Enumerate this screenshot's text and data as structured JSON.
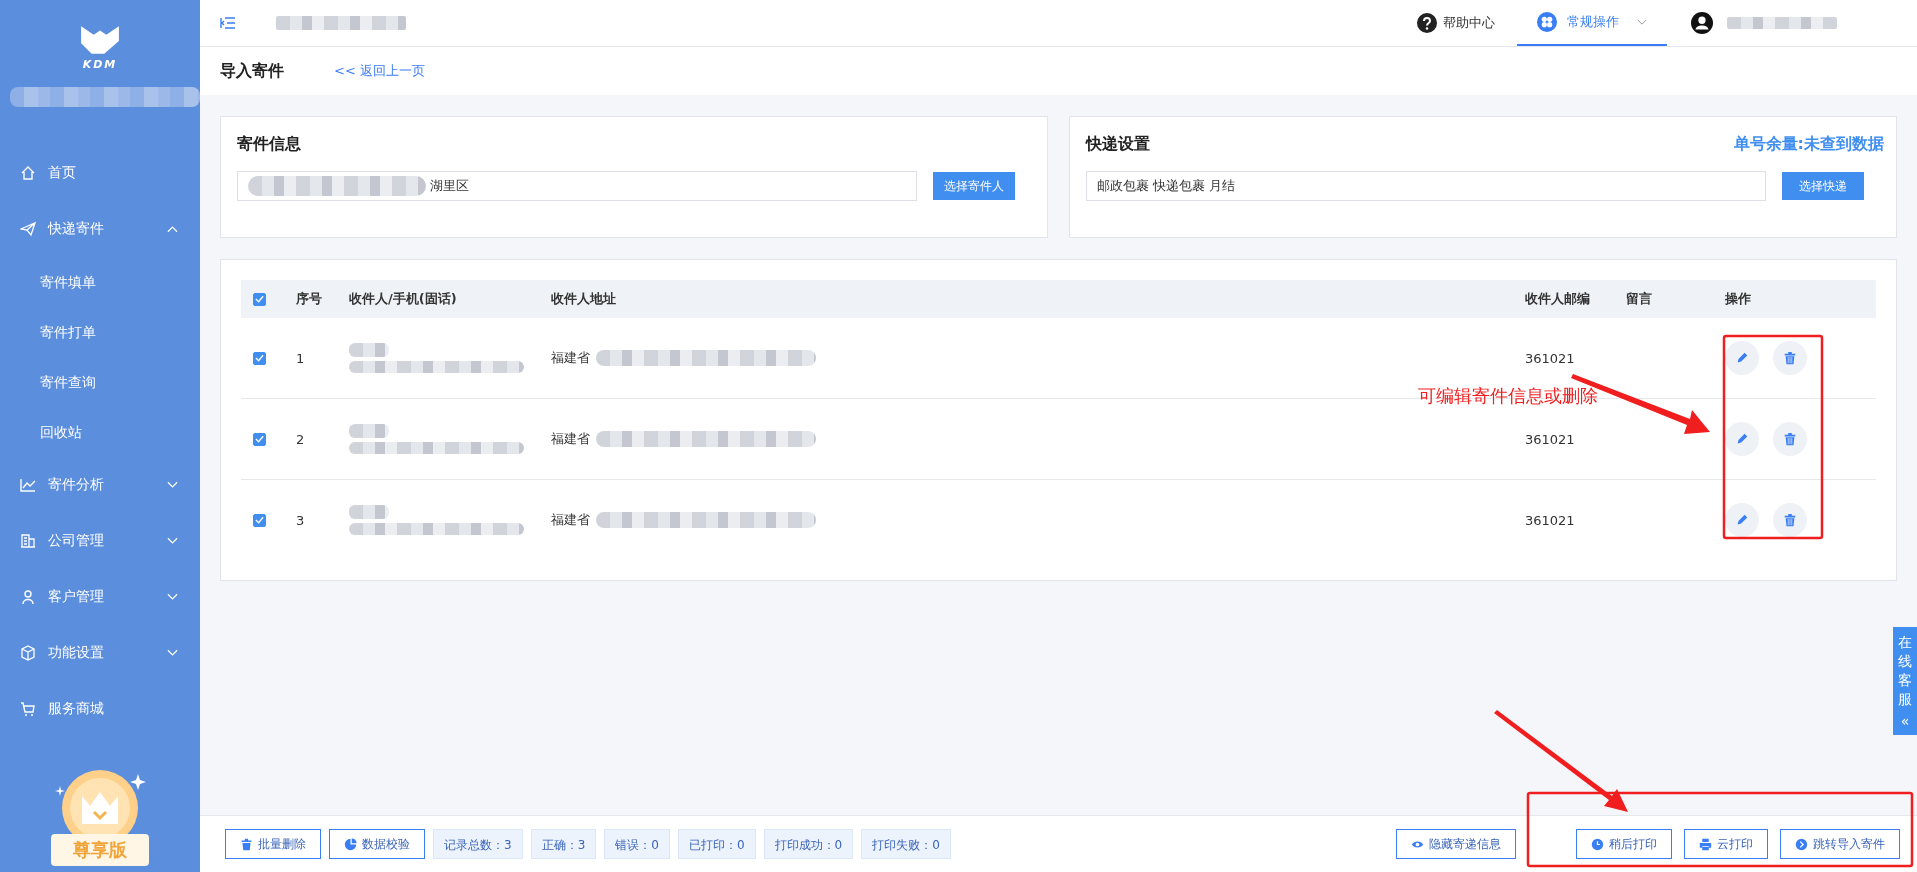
{
  "sidebar": {
    "logo_text": "KDM",
    "items": [
      {
        "kind": "home",
        "label": "首页"
      },
      {
        "kind": "send",
        "label": "快递寄件",
        "expanded": true,
        "children": [
          {
            "label": "寄件填单"
          },
          {
            "label": "寄件打单"
          },
          {
            "label": "寄件查询"
          },
          {
            "label": "回收站"
          }
        ]
      },
      {
        "kind": "chart",
        "label": "寄件分析",
        "expanded": false
      },
      {
        "kind": "building",
        "label": "公司管理",
        "expanded": false
      },
      {
        "kind": "person",
        "label": "客户管理",
        "expanded": false
      },
      {
        "kind": "box",
        "label": "功能设置",
        "expanded": false
      },
      {
        "kind": "cart",
        "label": "服务商城"
      }
    ],
    "badge": "尊享版"
  },
  "topbar": {
    "help": "帮助中心",
    "tabs": [
      {
        "label": "常规操作",
        "selected": true
      }
    ]
  },
  "page": {
    "title": "导入寄件",
    "back_link": "<< 返回上一页"
  },
  "sender_card": {
    "title": "寄件信息",
    "field_value": "湖里区",
    "button": "选择寄件人"
  },
  "express_card": {
    "title": "快递设置",
    "quota": "单号余量:未查到数据",
    "field_value": "邮政包裹 快递包裹 月结",
    "button": "选择快递"
  },
  "table": {
    "select_all_checked": true,
    "columns": [
      "序号",
      "收件人/手机(固话)",
      "收件人地址",
      "收件人邮编",
      "留言",
      "操作"
    ],
    "rows": [
      {
        "checked": true,
        "index": "1",
        "address": "福建省",
        "zip": "361021"
      },
      {
        "checked": true,
        "index": "2",
        "address": "福建省",
        "zip": "361021"
      },
      {
        "checked": true,
        "index": "3",
        "address": "福建省",
        "zip": "361021"
      }
    ]
  },
  "annotation": "可编辑寄件信息或删除",
  "footer": {
    "left_buttons": [
      {
        "kind": "delete",
        "label": "批量删除"
      },
      {
        "kind": "check",
        "label": "数据校验"
      }
    ],
    "stats": [
      "记录总数：3",
      "正确：3",
      "错误：0",
      "已打印：0",
      "打印成功：0",
      "打印失败：0"
    ],
    "right_buttons": [
      {
        "kind": "eye",
        "label": "隐藏寄递信息"
      },
      {
        "kind": "clock",
        "label": "稍后打印"
      },
      {
        "kind": "printer",
        "label": "云打印"
      },
      {
        "kind": "go",
        "label": "跳转导入寄件"
      }
    ]
  },
  "chat_tab": {
    "label": "在线客服",
    "toggle": "«"
  }
}
